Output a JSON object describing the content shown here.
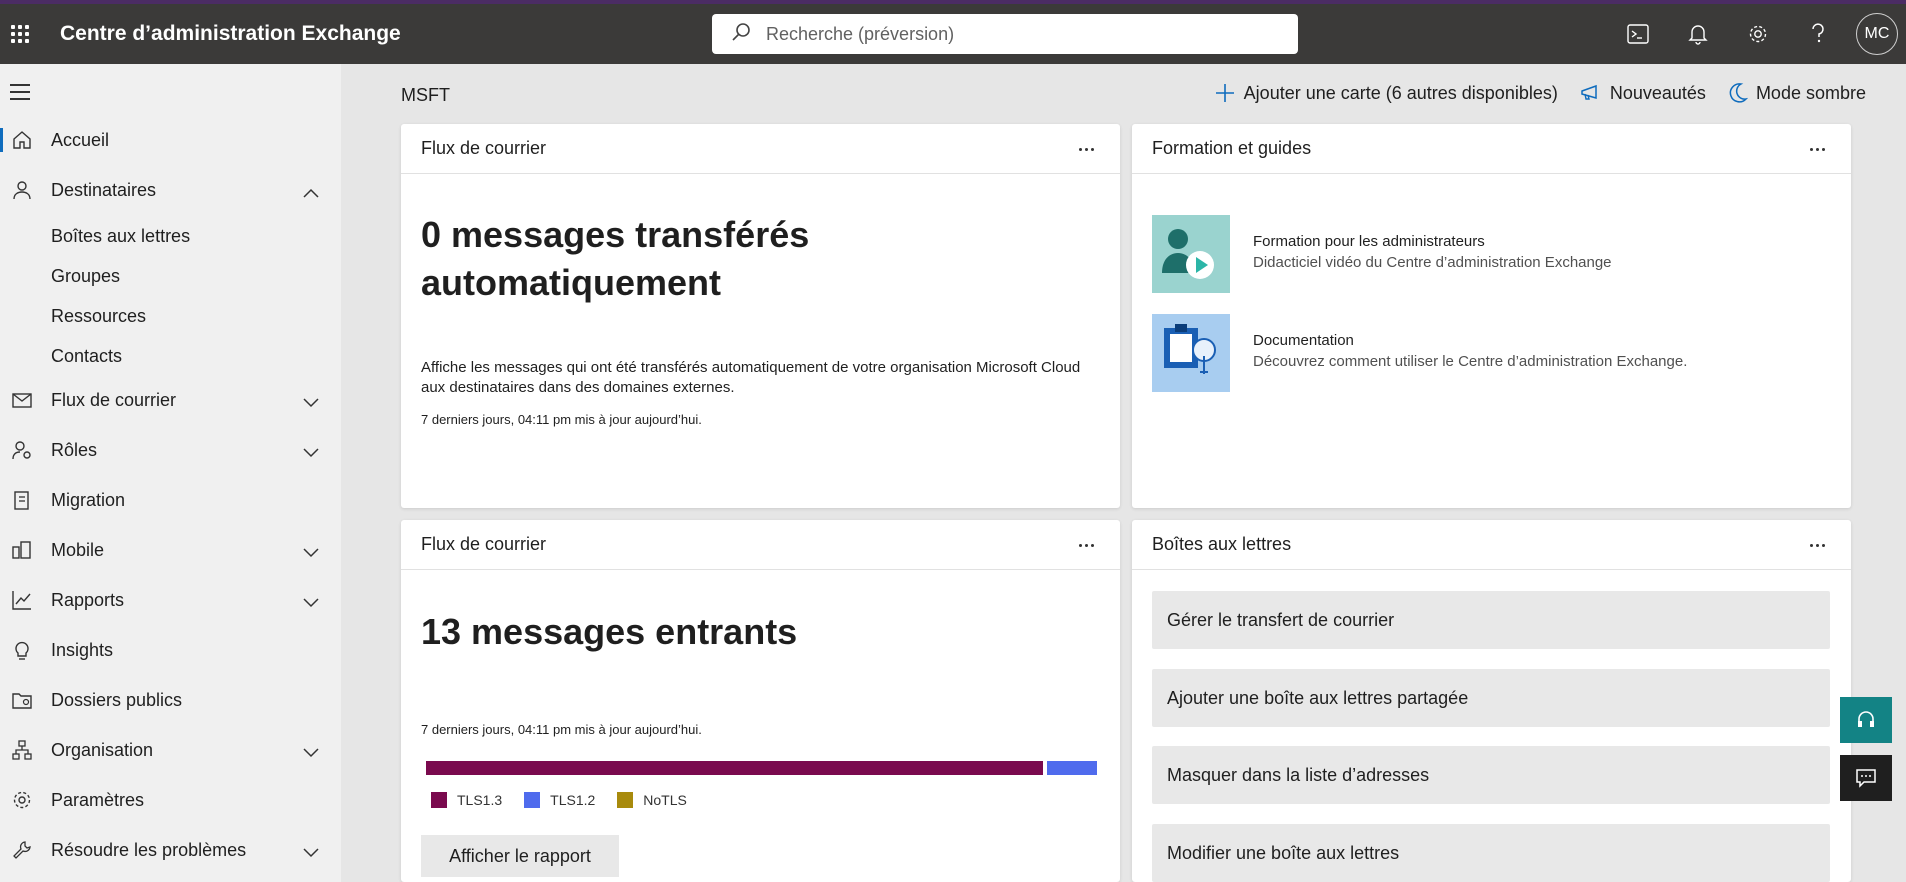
{
  "header": {
    "app_title": "Centre d’administration Exchange",
    "search_placeholder": "Recherche (préversion)",
    "avatar_initials": "MC",
    "colors": {
      "bar": "#3b3a39",
      "accent_line": "#4b2c64"
    },
    "icons": [
      "app-launcher-icon",
      "search-icon",
      "terminal-icon",
      "bell-icon",
      "gear-icon",
      "help-icon"
    ]
  },
  "sidebar": {
    "items": [
      {
        "label": "Accueil",
        "icon": "home-icon"
      },
      {
        "label": "Destinataires",
        "icon": "person-icon"
      },
      {
        "label": "Flux de courrier",
        "icon": "mail-icon"
      },
      {
        "label": "Rôles",
        "icon": "roles-icon"
      },
      {
        "label": "Migration",
        "icon": "migration-icon"
      },
      {
        "label": "Mobile",
        "icon": "mobile-icon"
      },
      {
        "label": "Rapports",
        "icon": "chart-icon"
      },
      {
        "label": "Insights",
        "icon": "lightbulb-icon"
      },
      {
        "label": "Dossiers publics",
        "icon": "folder-icon"
      },
      {
        "label": "Organisation",
        "icon": "org-icon"
      },
      {
        "label": "Paramètres",
        "icon": "gear-icon"
      },
      {
        "label": "Résoudre les problèmes",
        "icon": "wrench-icon"
      }
    ],
    "subitems": [
      "Boîtes aux lettres",
      "Groupes",
      "Ressources",
      "Contacts"
    ]
  },
  "main": {
    "tenant": "MSFT",
    "actions": {
      "add_card": "Ajouter une carte (6 autres disponibles)",
      "whats_new": "Nouveautés",
      "dark_mode": "Mode sombre"
    },
    "card_mailflow_1": {
      "title": "Flux de courrier",
      "headline_1": "0 messages transférés",
      "headline_2": "automatiquement",
      "description": "Affiche les messages qui ont été transférés automatiquement de votre organisation Microsoft Cloud aux destinataires dans des domaines externes.",
      "updated": "7 derniers jours, 04:11 pm mis à jour aujourd’hui."
    },
    "card_training": {
      "title": "Formation et guides",
      "items": [
        {
          "title": "Formation pour les administrateurs",
          "subtitle": "Didacticiel vidéo du Centre d’administration Exchange"
        },
        {
          "title": "Documentation",
          "subtitle": "Découvrez comment utiliser le Centre d’administration Exchange."
        }
      ]
    },
    "card_mailflow_2": {
      "title": "Flux de courrier",
      "headline": "13 messages entrants",
      "updated": "7 derniers jours, 04:11 pm mis à jour aujourd’hui.",
      "report_button": "Afficher le rapport"
    },
    "card_mailboxes": {
      "title": "Boîtes aux lettres",
      "buttons": [
        "Gérer le transfert de courrier",
        "Ajouter une boîte aux lettres partagée",
        "Masquer dans la liste d’adresses",
        "Modifier une boîte aux lettres"
      ]
    }
  },
  "chart_data": {
    "type": "bar",
    "orientation": "horizontal-stacked",
    "series": [
      {
        "name": "TLS1.3",
        "value": 0.92,
        "color": "#7a0a4e"
      },
      {
        "name": "TLS1.2",
        "value": 0.08,
        "color": "#4f6bed"
      },
      {
        "name": "NoTLS",
        "value": 0.0,
        "color": "#a88a0c"
      }
    ]
  }
}
